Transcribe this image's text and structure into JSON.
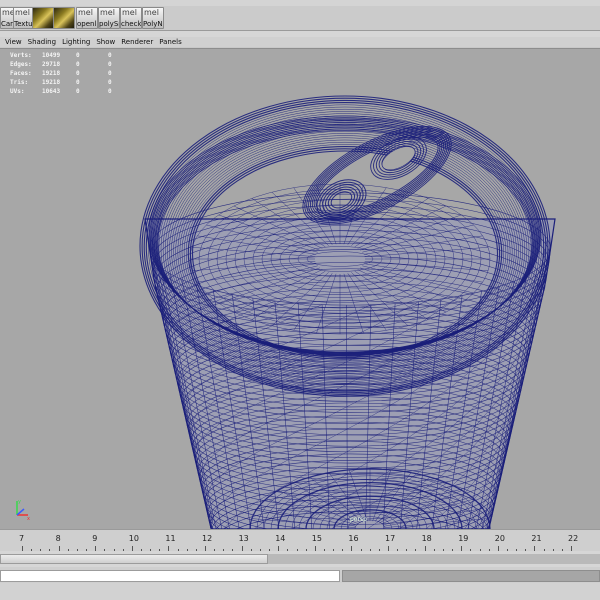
{
  "shelf": {
    "buttons": [
      {
        "label": "Car",
        "glyph": "mel",
        "style": "plain"
      },
      {
        "label": "Textu",
        "glyph": "mel",
        "style": "plain"
      },
      {
        "label": "",
        "glyph": "",
        "style": "img"
      },
      {
        "label": "",
        "glyph": "",
        "style": "img"
      },
      {
        "label": "openl",
        "glyph": "mel",
        "style": "plain"
      },
      {
        "label": "polySr",
        "glyph": "mel",
        "style": "plain"
      },
      {
        "label": "check",
        "glyph": "mel",
        "style": "plain"
      },
      {
        "label": "PolyN",
        "glyph": "mel",
        "style": "plain"
      }
    ]
  },
  "panel_menu": [
    "View",
    "Shading",
    "Lighting",
    "Show",
    "Renderer",
    "Panels"
  ],
  "hud": {
    "rows": [
      {
        "key": "Verts:",
        "v1": "10499",
        "v2": "0",
        "v3": "0"
      },
      {
        "key": "Edges:",
        "v1": "29718",
        "v2": "0",
        "v3": "0"
      },
      {
        "key": "Faces:",
        "v1": "19218",
        "v2": "0",
        "v3": "0"
      },
      {
        "key": "Tris:",
        "v1": "19218",
        "v2": "0",
        "v3": "0"
      },
      {
        "key": "UVs:",
        "v1": "10643",
        "v2": "0",
        "v3": "0"
      }
    ]
  },
  "camera_label": "persp",
  "time_slider": {
    "ticks": [
      "7",
      "8",
      "9",
      "10",
      "11",
      "12",
      "13",
      "14",
      "15",
      "16",
      "17",
      "18",
      "19",
      "20",
      "21",
      "22"
    ]
  },
  "colors": {
    "wireframe": "#1b1f7a",
    "viewport_bg": "#a7a7a7",
    "hud_text": "#f4f4f4"
  }
}
